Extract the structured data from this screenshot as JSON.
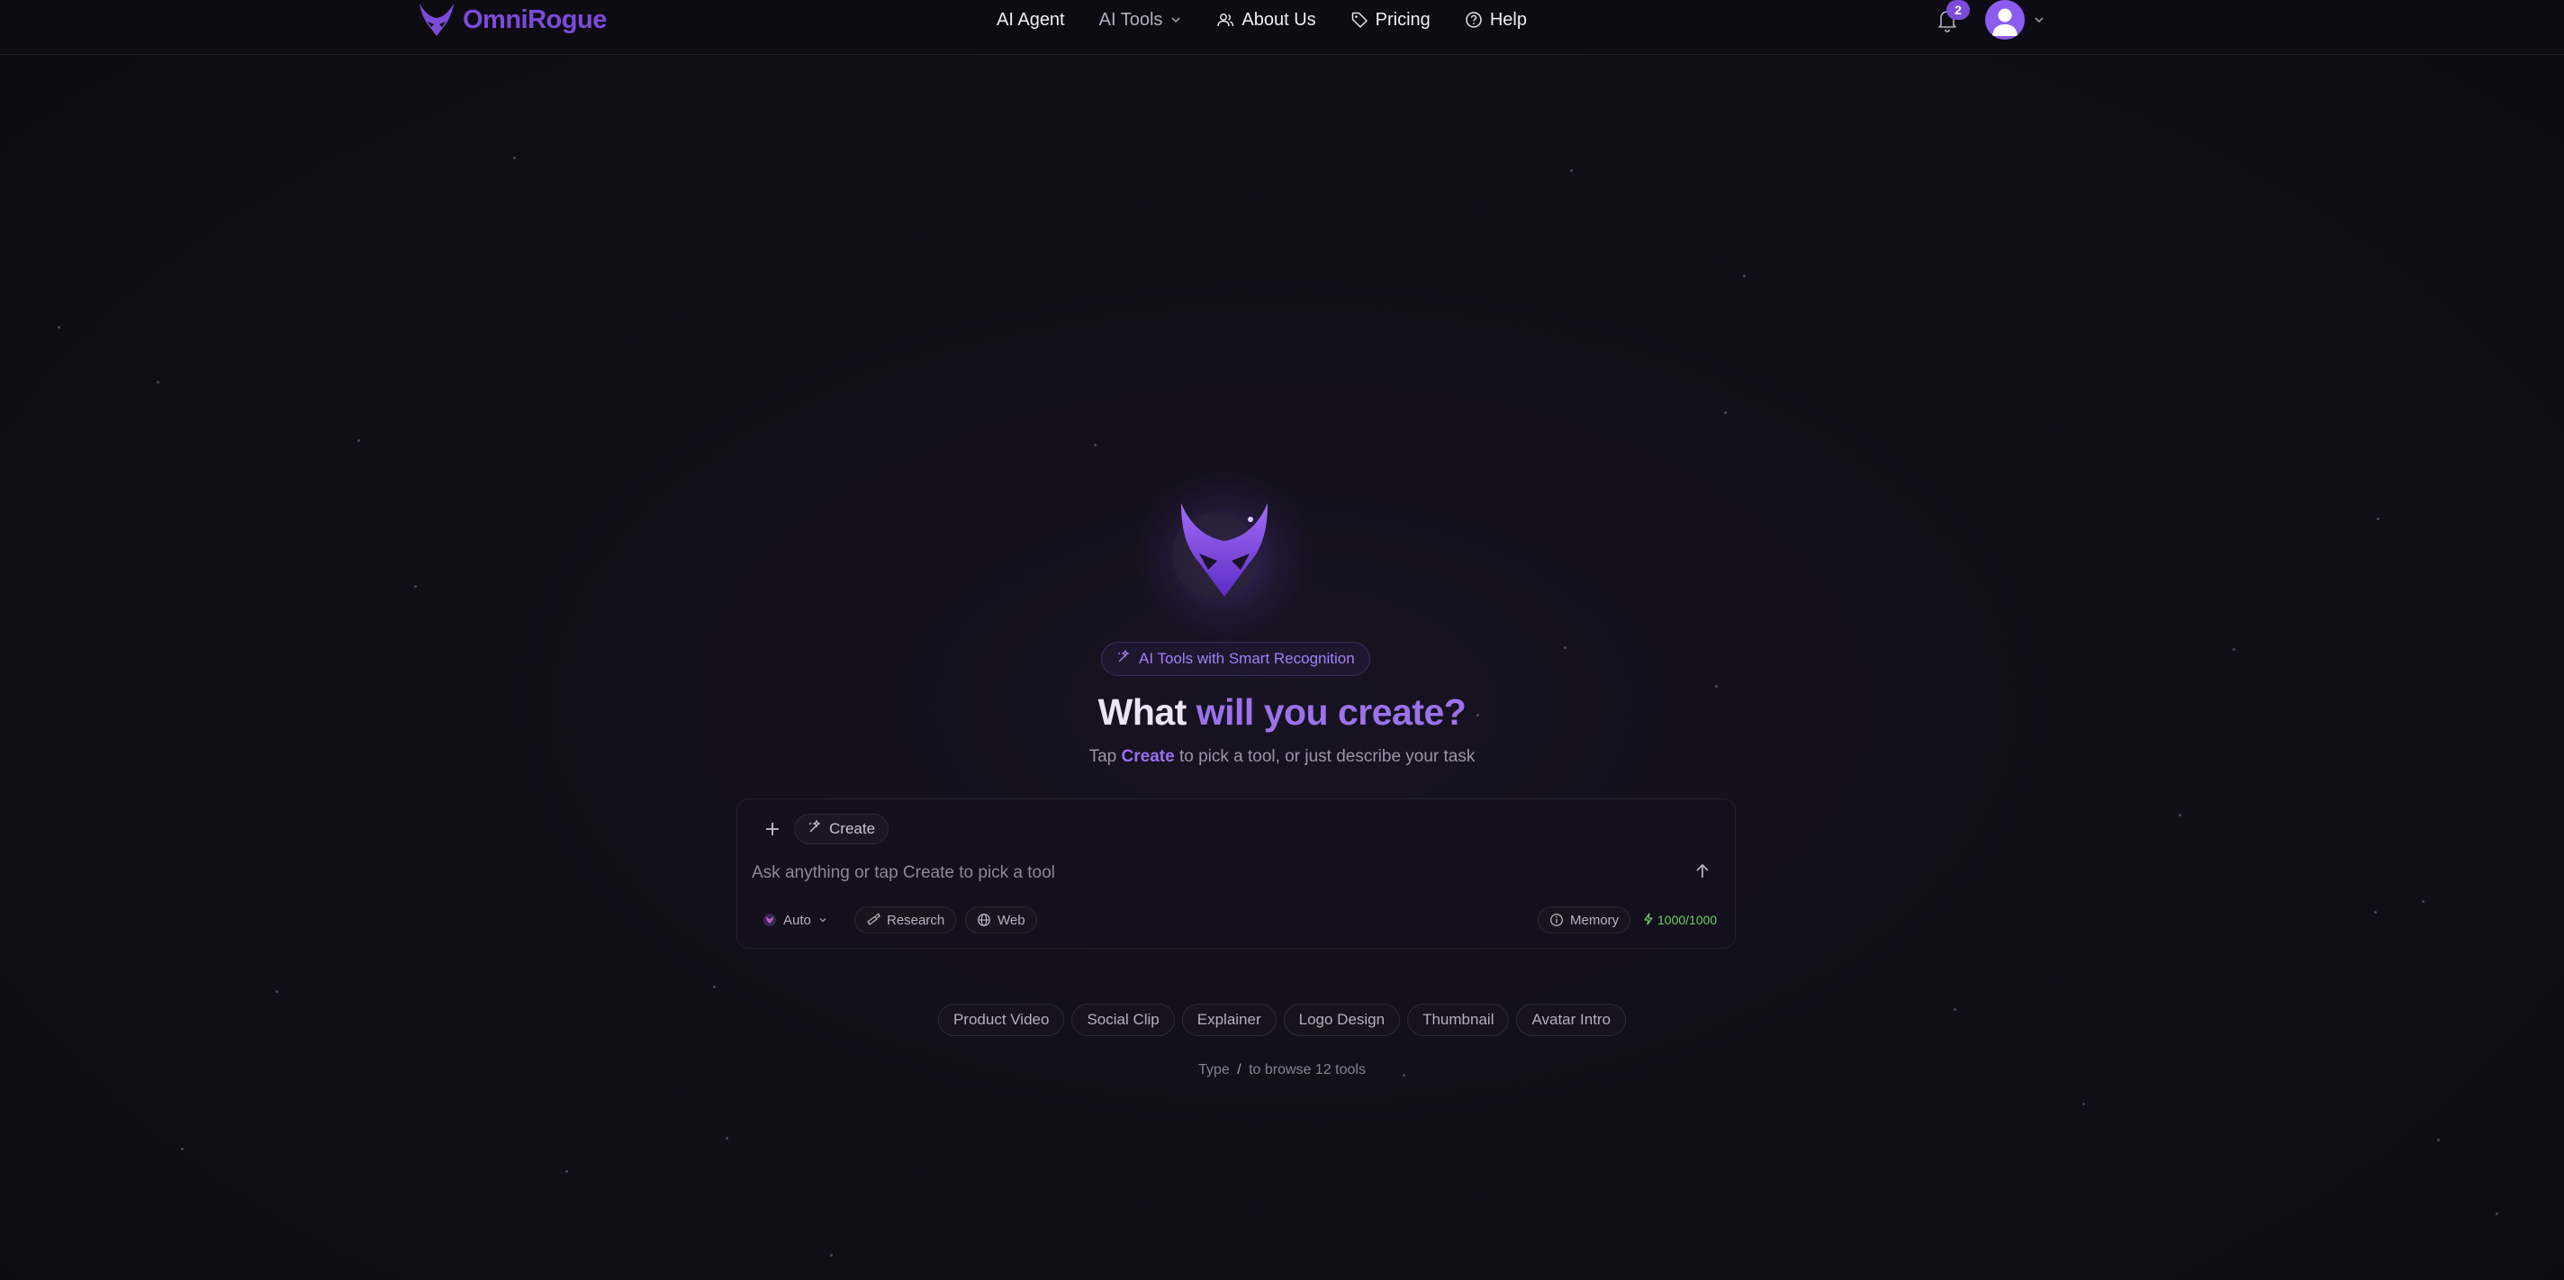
{
  "brand": {
    "name": "OmniRogue",
    "accent": "#7b4bd9"
  },
  "nav": {
    "links": [
      {
        "label": "AI Agent",
        "icon": ""
      },
      {
        "label": "AI Tools",
        "icon": "chevron-down-icon"
      },
      {
        "label": "About Us",
        "icon": "users-icon"
      },
      {
        "label": "Pricing",
        "icon": "tag-icon"
      },
      {
        "label": "Help",
        "icon": "help-circle-icon"
      }
    ],
    "notifications_count": "2"
  },
  "hero": {
    "badge": "AI Tools with Smart Recognition",
    "headline_start": "What ",
    "headline_accent": "will you create?",
    "sub_before": "Tap ",
    "sub_create": "Create",
    "sub_after": " to pick a tool, or just describe your task"
  },
  "composer": {
    "create_label": "Create",
    "placeholder": "Ask anything or tap Create to pick a tool",
    "model_label": "Auto",
    "research_label": "Research",
    "web_label": "Web",
    "memory_label": "Memory",
    "credits": "1000/1000",
    "credits_color": "#6fcf6a"
  },
  "suggestions": [
    "Product Video",
    "Social Clip",
    "Explainer",
    "Logo Design",
    "Thumbnail",
    "Avatar Intro"
  ],
  "hint": {
    "before": "Type ",
    "key": "/",
    "after": " to browse 12 tools"
  }
}
